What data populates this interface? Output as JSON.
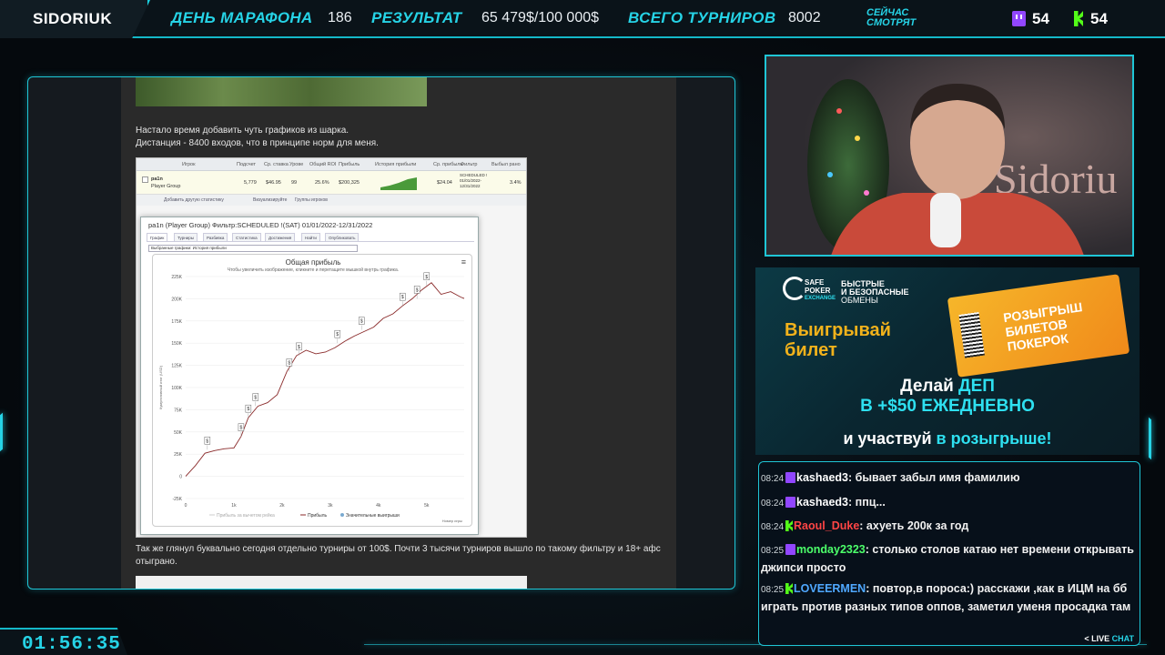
{
  "topbar": {
    "brand": "SIDORIUK",
    "marathon_label": "ДЕНЬ МАРАФОНА",
    "marathon_value": "186",
    "result_label": "РЕЗУЛЬТАТ",
    "result_value": "65 479$/100 000$",
    "tournaments_label": "ВСЕГО ТУРНИРОВ",
    "tournaments_value": "8002",
    "watching_line1": "СЕЙЧАС",
    "watching_line2": "СМОТРЯТ",
    "twitch_count": "54",
    "kick_count": "54"
  },
  "timer": "01:56:35",
  "document": {
    "paragraph1_line1": "Настало время добавить чуть графиков из шарка.",
    "paragraph1_line2": "Дистанция - 8400 входов, что в принципе норм для меня.",
    "paragraph2": "Так же глянул буквально сегодня отдельно турниры от 100$. Почти 3 тысячи турниров вышло по такому фильтру и 18+ афс отыграно.",
    "table_headers": [
      "Игрок",
      "Подсчет",
      "Ср. ставка",
      "Урове",
      "Общий ROI",
      "Прибыль",
      "История прибыли",
      "Ср. прибыль",
      "Фильтр",
      "Выбыл рано"
    ],
    "table_row": {
      "player": "pa1n",
      "group": "Player Group",
      "count": "5,779",
      "avg_stake": "$46.95",
      "level": "99",
      "roi": "25.6%",
      "profit": "$200,325",
      "avg_profit": "$24.04",
      "filter_line1": "SCHEDULED !",
      "filter_line2": "01/01/2022-",
      "filter_line3": "12/31/2022",
      "early": "3.4%"
    },
    "tools": [
      "Добавить другую статистику",
      "Визуализируйте",
      "Группы игроков"
    ],
    "dialog_title": "pa1n (Player Group) Фильтр:SCHEDULED !(SAT) 01/01/2022-12/31/2022",
    "dialog_tabs": [
      "График",
      "Турниры",
      "Разбивка",
      "Статистика",
      "Достижения",
      "Найти",
      "Опубликовать"
    ],
    "dialog_select": "Выбранные графики: История прибыли"
  },
  "chart_data": {
    "type": "line",
    "title": "Общая прибыль",
    "subtitle": "Чтобы увеличить изображение, кликните и перетащите мышкой внутрь графика.",
    "xlabel": "",
    "ylabel": "Кумулятивный итог (USD)",
    "x_right_label": "Номер игры",
    "x_ticks": [
      "0",
      "1k",
      "2k",
      "3k",
      "4k",
      "5k"
    ],
    "y_ticks": [
      "-25K",
      "0",
      "25K",
      "50K",
      "75K",
      "100K",
      "125K",
      "150K",
      "175K",
      "200K",
      "225K"
    ],
    "xlim": [
      0,
      5779
    ],
    "ylim": [
      -25000,
      225000
    ],
    "series": [
      {
        "name": "Прибыль",
        "x": [
          0,
          200,
          400,
          600,
          800,
          1000,
          1150,
          1300,
          1500,
          1700,
          1900,
          2100,
          2300,
          2500,
          2700,
          2900,
          3100,
          3300,
          3500,
          3700,
          3900,
          4100,
          4300,
          4500,
          4700,
          4900,
          5100,
          5300,
          5500,
          5700,
          5779
        ],
        "y": [
          0,
          12000,
          26000,
          29000,
          31000,
          32000,
          45000,
          66000,
          79000,
          83000,
          92000,
          118000,
          136000,
          142000,
          138000,
          140000,
          145000,
          152000,
          158000,
          163000,
          168000,
          178000,
          183000,
          192000,
          200000,
          210000,
          218000,
          205000,
          208000,
          202000,
          200325
        ]
      },
      {
        "name": "Прибыль за вычетом рейка",
        "y": []
      },
      {
        "name": "Значительные выигрыши",
        "x": [
          450,
          1150,
          1300,
          1450,
          2150,
          2350,
          3150,
          3650,
          4500,
          4800,
          5000
        ],
        "y": [
          30000,
          45000,
          66000,
          79000,
          118000,
          136000,
          150000,
          165000,
          192000,
          200000,
          215000
        ]
      }
    ],
    "legend": [
      "Прибыль за вычетом рейка",
      "Прибыль",
      "Значительные выигрыши"
    ],
    "legend_position": "bottom"
  },
  "ad": {
    "brand_line1": "SAFE",
    "brand_line2": "POKER",
    "brand_line3": "EXCHANGE",
    "tagline_line1": "БЫСТРЫЕ",
    "tagline_line2": "И БЕЗОПАСНЫЕ",
    "tagline_line3": "ОБМЕНЫ",
    "win_line1": "Выигрывай",
    "win_line2": "билет",
    "ticket_line1": "РОЗЫГРЫШ",
    "ticket_line2": "БИЛЕТОВ",
    "ticket_line3": "ПОКЕРОК",
    "deposit_pre": "Делай ",
    "deposit_hl": "ДЕП",
    "deposit_line2": "В +$50 ЕЖЕДНЕВНО",
    "cta_pre": "и участвуй ",
    "cta_hl": "в розыгрыше!",
    "colors": {
      "accent": "#2ee0f0",
      "gold": "#f2b21b",
      "orange": "#f08a1a"
    }
  },
  "chat": {
    "messages": [
      {
        "time": "08:24",
        "platform": "twitch",
        "user": "kashaed3",
        "user_color": "#ffffff",
        "text": "бывает забыл имя фамилию"
      },
      {
        "time": "08:24",
        "platform": "twitch",
        "user": "kashaed3",
        "user_color": "#ffffff",
        "text": "ппц..."
      },
      {
        "time": "08:24",
        "platform": "kick",
        "user": "Raoul_Duke",
        "user_color": "#ff4545",
        "text": "ахуеть 200к за год"
      },
      {
        "time": "08:25",
        "platform": "twitch",
        "user": "monday2323",
        "user_color": "#4cff6a",
        "text": "столько столов катаю нет времени открывать джипси просто"
      },
      {
        "time": "08:25",
        "platform": "kick",
        "user": "LOVEERMEN",
        "user_color": "#4fa8ff",
        "text": "повтор,в пороса:) расскажи ,как в ИЦМ на бб играть против разных типов оппов, заметил уменя просадка там"
      }
    ],
    "live_pre": "< LIVE",
    "live_hl": "CHAT"
  }
}
